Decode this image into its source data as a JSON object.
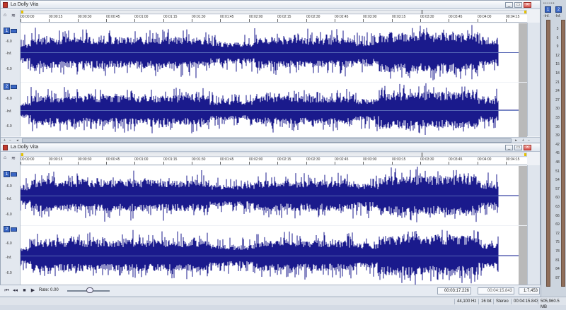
{
  "app": {
    "document_title": "La Dolly Vita"
  },
  "window_buttons": {
    "minimize": "_",
    "restore": "▭",
    "close": "✕"
  },
  "timeline": {
    "ticks": [
      "00:00:00",
      "00:00:15",
      "00:00:30",
      "00:00:45",
      "00:01:00",
      "00:01:15",
      "00:01:30",
      "00:01:45",
      "00:02:00",
      "00:02:15",
      "00:02:30",
      "00:02:45",
      "00:03:00",
      "00:03:15",
      "00:03:30",
      "00:03:45",
      "00:04:00",
      "00:04:15"
    ]
  },
  "channels": {
    "ch1_label": "1",
    "ch2_label": "2",
    "db_top": "-6.0",
    "db_mid": "-Inf.",
    "db_bottom": "-6.0"
  },
  "waveform_color": "#1a1a8c",
  "transport": {
    "rate_label": "Rate: 0.00",
    "position": "00:03:17.226",
    "length": "00:04:15.843",
    "zoom": "1:7,453"
  },
  "statusbar": {
    "sample_rate": "44,100 Hz",
    "bit_depth": "16 bit",
    "channels": "Stereo",
    "duration": "00:04:15.843",
    "disk_space": "505,960.5 MB"
  },
  "meters": {
    "header": "••••••",
    "ch1": "1",
    "ch2": "2",
    "peak_left": "-Inf.",
    "peak_right": "-Inf.",
    "scale": [
      "3",
      "6",
      "9",
      "12",
      "15",
      "18",
      "21",
      "24",
      "27",
      "30",
      "33",
      "36",
      "39",
      "42",
      "45",
      "48",
      "51",
      "54",
      "57",
      "60",
      "63",
      "66",
      "69",
      "72",
      "75",
      "78",
      "81",
      "84",
      "87"
    ]
  },
  "icons": {
    "lock": "lock-icon",
    "snap": "snap-icon",
    "first": "go-to-start-icon",
    "prev": "rewind-icon",
    "stop": "stop-icon",
    "play": "play-icon"
  }
}
